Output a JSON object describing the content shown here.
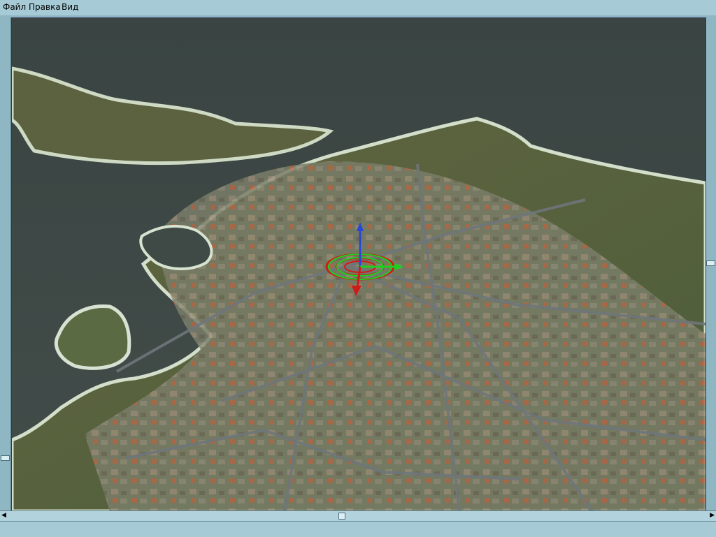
{
  "menu": {
    "file_label": "Файл",
    "edit_label": "Правка",
    "view_label": "Вид"
  },
  "colors": {
    "sea": "#3e4a47",
    "land": "#6f7548",
    "city": "#8c8d82",
    "road": "#70767a",
    "gizmo_ring": "#d11a1a",
    "gizmo_axis_green": "#19d21f",
    "gizmo_axis_blue": "#2a45d6"
  },
  "icons": {
    "scroll_left": "left-arrow-icon",
    "scroll_right": "right-arrow-icon",
    "gizmo": "transform-gizmo-icon"
  }
}
